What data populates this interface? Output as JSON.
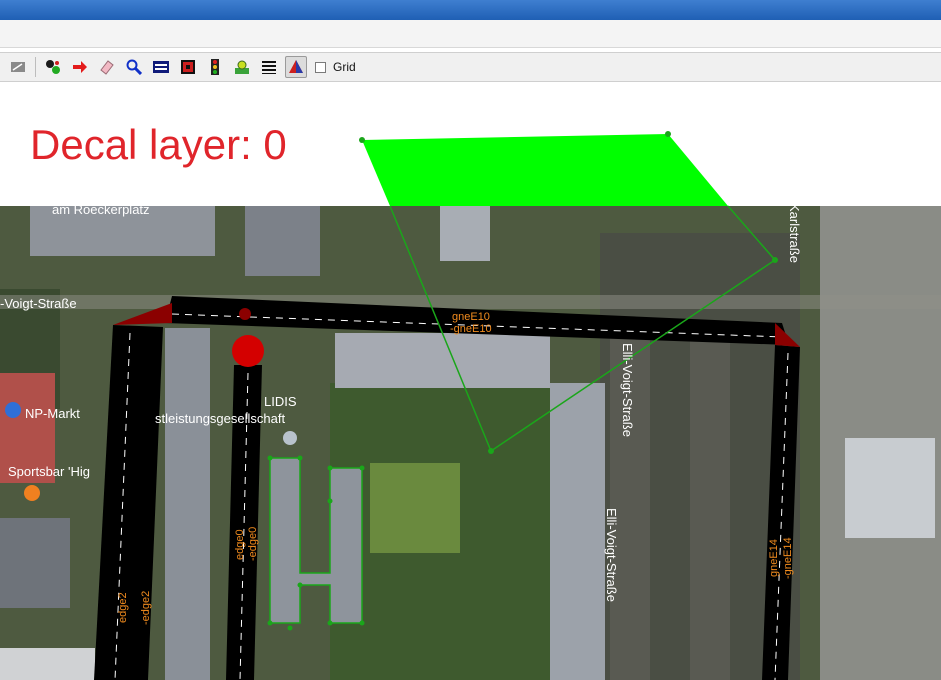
{
  "toolbar": {
    "grid_label": "Grid",
    "grid_checked": false,
    "buttons": [
      "edit-icon",
      "select-icon",
      "move-icon",
      "delete-icon",
      "inspect-icon",
      "crossing-icon",
      "connection-icon",
      "traffic-light-icon",
      "additional-icon",
      "wire-icon",
      "prohibition-icon"
    ]
  },
  "viewport": {
    "decal_label": "Decal layer: 0"
  },
  "map": {
    "streets": {
      "top_left": "-Voigt-Straße",
      "middle": "Elli-Voigt-Straße",
      "lower": "Elli-Voigt-Straße",
      "right": "Karlstraße",
      "top": "am Roeckerplatz"
    },
    "pois": {
      "np_markt": "NP-Markt",
      "sportsbar": "Sportsbar 'Hig",
      "lidis": "LIDIS",
      "lidis_sub": "stleistungsgesellschaft"
    },
    "edges": {
      "gneE10": "gneE10",
      "gneE10_rev": "-gneE10",
      "edge0": "edge0",
      "edge0_rev": "-edge0",
      "edge2": "edge2",
      "edge2_rev": "-edge2",
      "gneE14": "gneE14",
      "gneE14_rev": "-gneE14"
    },
    "colors": {
      "decal_label": "#e0252b",
      "polygon_fill": "#00ff00",
      "polygon_outline": "#1aa61a",
      "edge_label": "#f28c1e",
      "road": "#000000",
      "junction": "#8b0000",
      "vehicle": "#d40000"
    }
  }
}
